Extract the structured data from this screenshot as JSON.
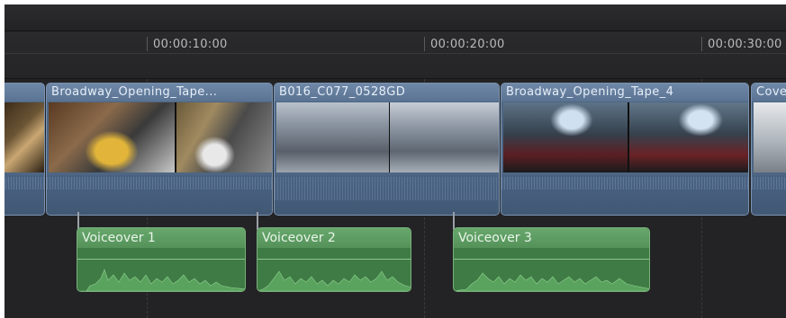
{
  "ruler": {
    "ticks": [
      "00:00:10:00",
      "00:00:20:00",
      "00:00:30:00"
    ]
  },
  "clips": [
    {
      "title": ""
    },
    {
      "title": "Broadway_Opening_Tape..."
    },
    {
      "title": "B016_C077_0528GD"
    },
    {
      "title": "Broadway_Opening_Tape_4"
    },
    {
      "title": "Cove"
    }
  ],
  "voiceovers": [
    {
      "title": "Voiceover 1"
    },
    {
      "title": "Voiceover 2"
    },
    {
      "title": "Voiceover 3"
    }
  ],
  "colors": {
    "primary_clip": "#4e6684",
    "clip_header": "#6f88a8",
    "voiceover_clip": "#3f7b45",
    "voiceover_header": "#68a86c",
    "background": "#1d1d1f"
  }
}
